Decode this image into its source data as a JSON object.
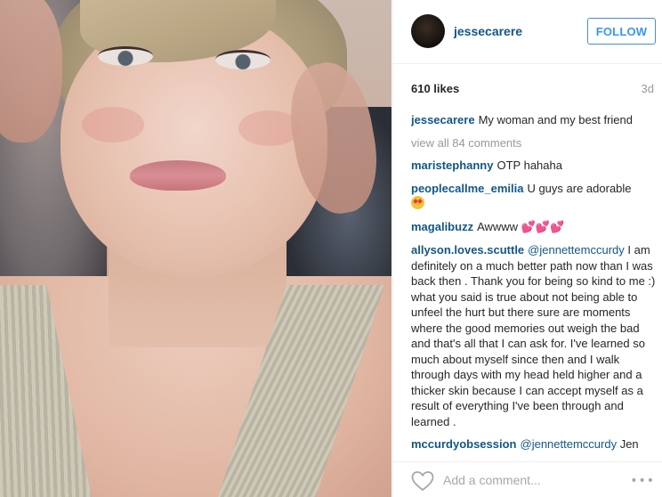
{
  "post": {
    "image_alt": "Selfie photo of a woman with blonde bangs, pink lipstick, and a sequined dress"
  },
  "header": {
    "username": "jessecarere",
    "follow_label": "FOLLOW"
  },
  "stats": {
    "likes": "610 likes",
    "age": "3d"
  },
  "caption": {
    "user": "jessecarere",
    "text": "My woman and my best friend"
  },
  "view_all": "view all 84 comments",
  "comments": [
    {
      "user": "maristephanny",
      "text": "OTP hahaha"
    },
    {
      "user": "peoplecallme_emilia",
      "text": "U guys are adorable",
      "emoji": "heart-eyes"
    },
    {
      "user": "magalibuzz",
      "text": "Awwww",
      "emoji_text": "💕💕💕"
    },
    {
      "user": "allyson.loves.scuttle",
      "mention": "@jennettemccurdy",
      "text": "I am definitely on a much better path now than I was back then . Thank you for being so kind to me :) what you said is true about not being able to unfeel the hurt but there sure are moments where the good memories out weigh the bad and that's all that I can ask for. I've learned so much about myself since then and I walk through days with my head held higher and a thicker skin because I can accept myself as a result of everything I've been through and learned ."
    },
    {
      "user": "mccurdyobsession",
      "mention": "@jennettemccurdy",
      "text": "Jen"
    }
  ],
  "footer": {
    "comment_placeholder": "Add a comment...",
    "more_symbol": "•••"
  },
  "colors": {
    "username_blue": "#125688",
    "follow_blue": "#3897f0",
    "muted_gray": "#999999"
  }
}
